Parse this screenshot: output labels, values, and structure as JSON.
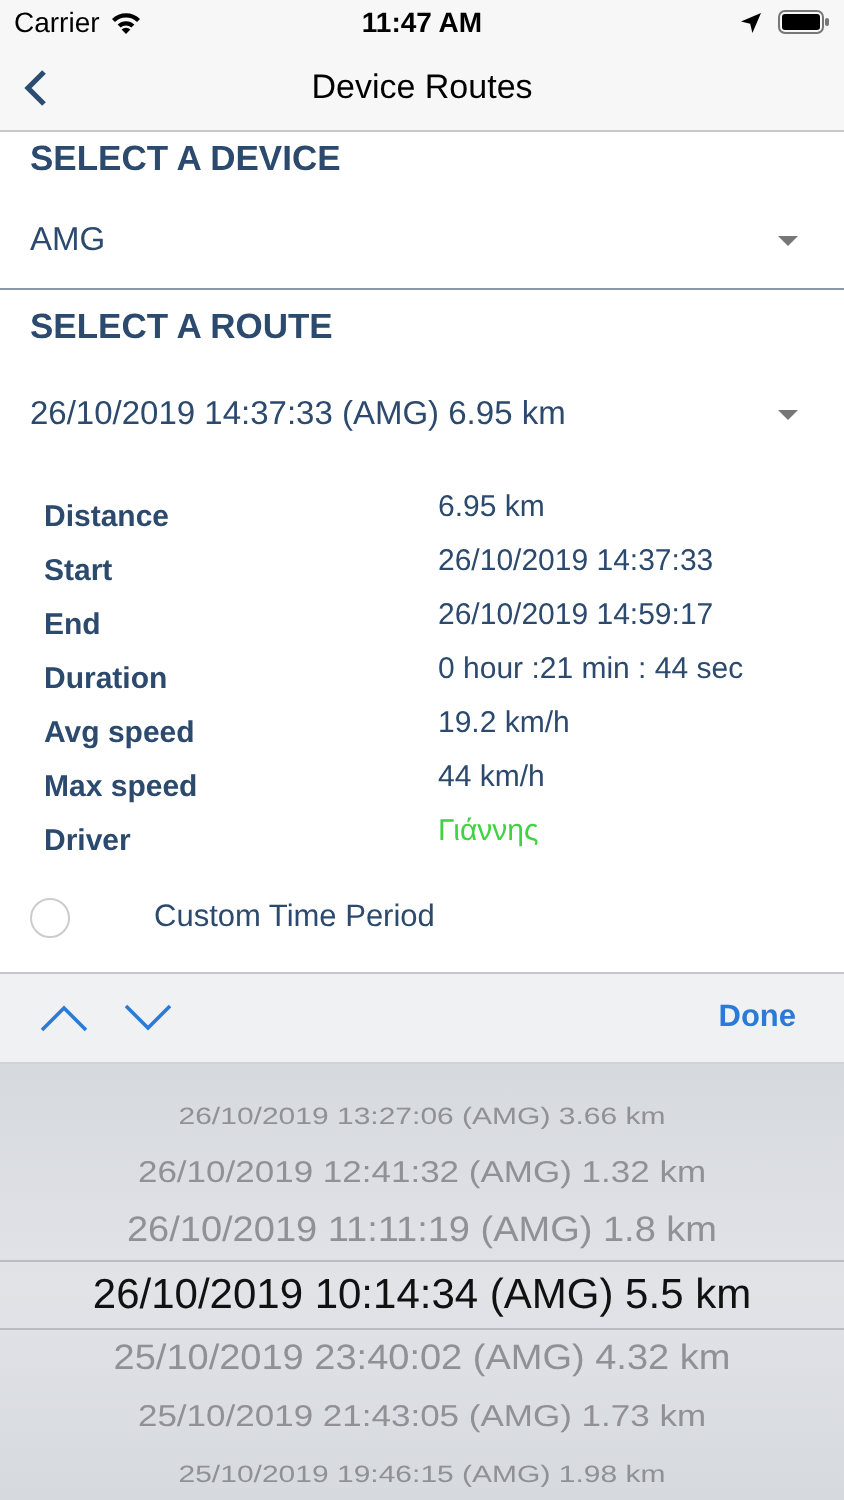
{
  "status_bar": {
    "carrier": "Carrier",
    "time": "11:47 AM"
  },
  "nav": {
    "title": "Device Routes"
  },
  "device": {
    "heading": "SELECT A DEVICE",
    "value": "AMG"
  },
  "route": {
    "heading": "SELECT A ROUTE",
    "value": "26/10/2019 14:37:33 (AMG) 6.95 km"
  },
  "details": [
    {
      "label": "Distance",
      "value": "6.95 km"
    },
    {
      "label": "Start",
      "value": "26/10/2019 14:37:33"
    },
    {
      "label": "End",
      "value": "26/10/2019 14:59:17"
    },
    {
      "label": "Duration",
      "value": "0 hour :21 min : 44 sec"
    },
    {
      "label": "Avg speed",
      "value": "19.2 km/h"
    },
    {
      "label": "Max speed",
      "value": "44 km/h"
    },
    {
      "label": "Driver",
      "value": "Γιάννης",
      "color": "#3fd33f"
    }
  ],
  "custom_period": {
    "label": "Custom Time Period",
    "checked": false
  },
  "toolbar": {
    "done": "Done"
  },
  "picker": [
    {
      "label": "26/10/2019 13:27:06 (AMG) 3.66 km",
      "selected": false
    },
    {
      "label": "26/10/2019 12:41:32 (AMG) 1.32 km",
      "selected": false
    },
    {
      "label": "26/10/2019 11:11:19 (AMG) 1.8 km",
      "selected": false
    },
    {
      "label": "26/10/2019 10:14:34 (AMG) 5.5 km",
      "selected": true
    },
    {
      "label": "25/10/2019 23:40:02 (AMG) 4.32 km",
      "selected": false
    },
    {
      "label": "25/10/2019 21:43:05 (AMG) 1.73 km",
      "selected": false
    },
    {
      "label": "25/10/2019 19:46:15 (AMG) 1.98 km",
      "selected": false
    }
  ]
}
